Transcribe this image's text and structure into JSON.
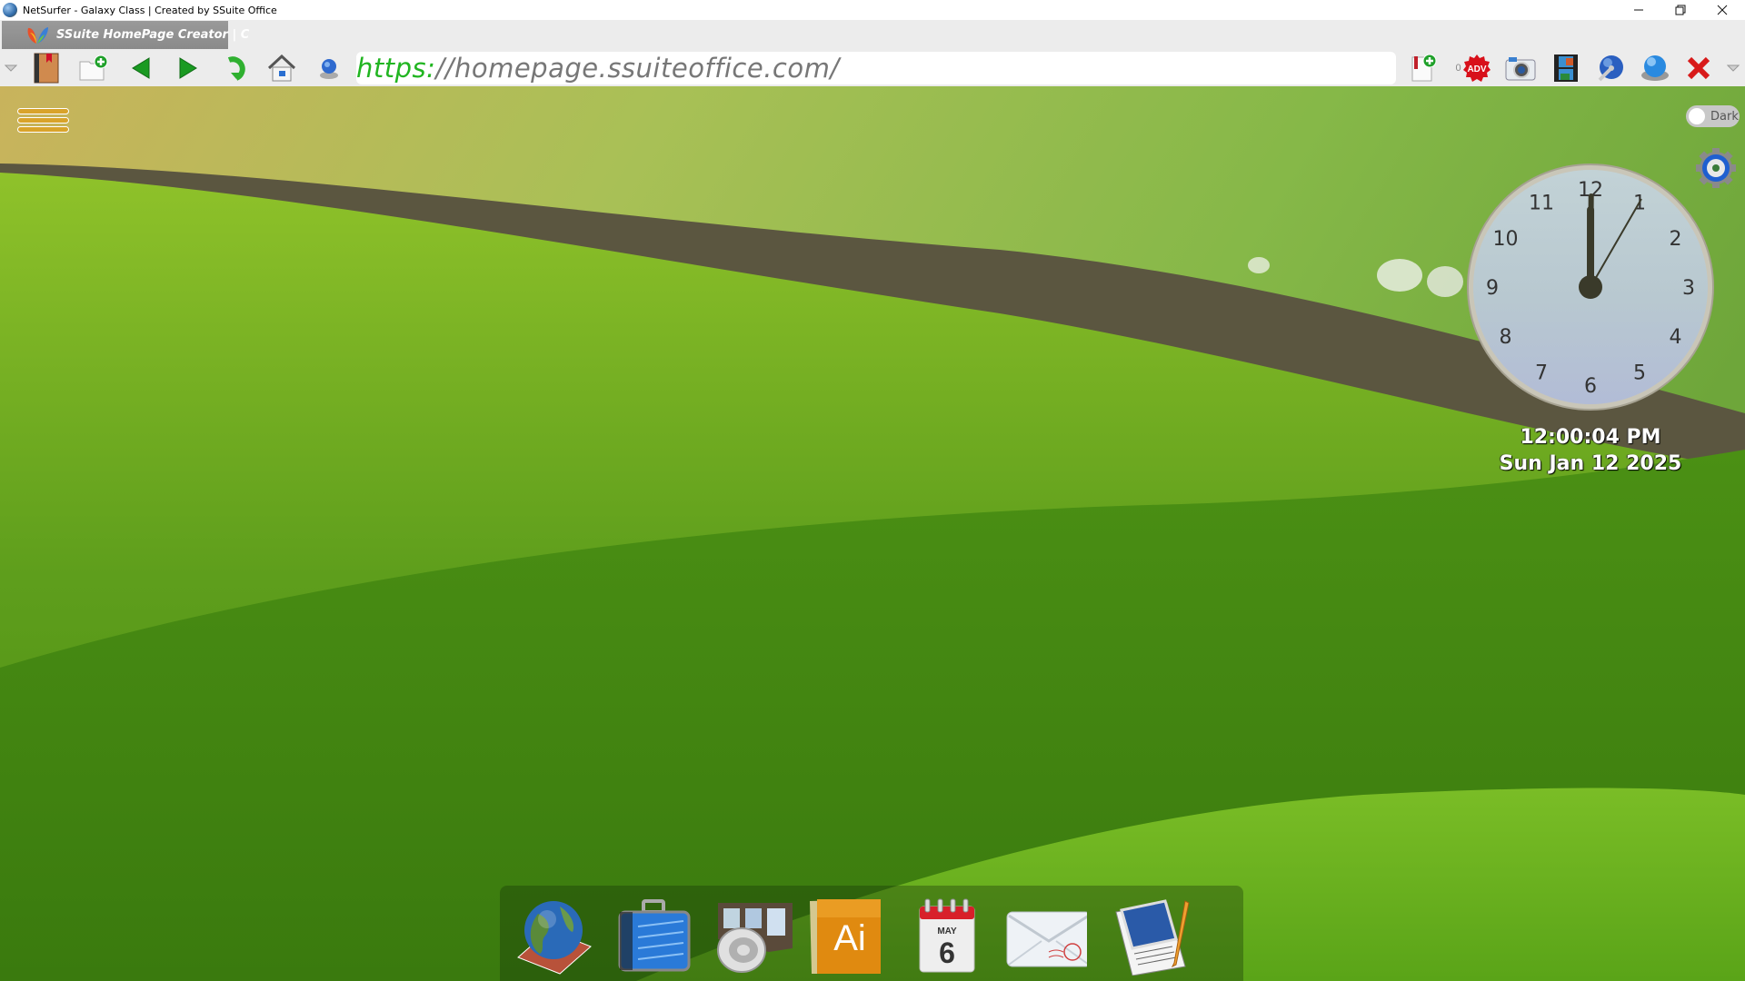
{
  "window": {
    "title": "NetSurfer - Galaxy Class | Created by SSuite Office",
    "controls": {
      "minimize": "—",
      "restore": "❐",
      "close": "✕"
    }
  },
  "tabs": [
    {
      "title": "SSuite HomePage Creator | C",
      "icon": "ssuite-butterfly-icon",
      "active": true
    }
  ],
  "toolbar": {
    "left_buttons": [
      {
        "name": "tab-menu-dropdown",
        "icon": "chevron-down-icon"
      },
      {
        "name": "bookmarks",
        "icon": "bookmark-book-icon"
      },
      {
        "name": "new-tab",
        "icon": "new-tab-plus-icon"
      },
      {
        "name": "back",
        "icon": "arrow-left-icon"
      },
      {
        "name": "forward",
        "icon": "arrow-right-icon"
      },
      {
        "name": "reload",
        "icon": "reload-icon"
      },
      {
        "name": "home",
        "icon": "home-icon"
      },
      {
        "name": "site-info",
        "icon": "globe-icon"
      }
    ],
    "url": {
      "scheme": "https:",
      "rest": "//homepage.ssuiteoffice.com/"
    },
    "right_buttons": [
      {
        "name": "add-bookmark",
        "icon": "bookmark-add-icon"
      },
      {
        "name": "adblock",
        "icon": "adv-badge-icon",
        "count": "0",
        "label": "ADV"
      },
      {
        "name": "screenshot",
        "icon": "camera-icon"
      },
      {
        "name": "media",
        "icon": "film-icon"
      },
      {
        "name": "settings-tools",
        "icon": "wrench-globe-icon"
      },
      {
        "name": "network",
        "icon": "globe-gear-icon"
      },
      {
        "name": "close-tab",
        "icon": "close-x-icon"
      },
      {
        "name": "more-dropdown",
        "icon": "chevron-down-icon"
      }
    ]
  },
  "page": {
    "menu_icon": "hamburger-icon",
    "theme_toggle": {
      "label": "Dark",
      "on": false
    },
    "settings_icon": "gear-icon",
    "clock": {
      "numerals": [
        "12",
        "1",
        "2",
        "3",
        "4",
        "5",
        "6",
        "7",
        "8",
        "9",
        "10",
        "11"
      ],
      "hours": 12,
      "minutes": 0,
      "seconds": 4
    },
    "time_text": "12:00:04 PM",
    "date_text": "Sun Jan 12 2025",
    "dock": [
      {
        "name": "web-browser",
        "icon": "globe-book-icon"
      },
      {
        "name": "briefcase",
        "icon": "briefcase-icon"
      },
      {
        "name": "multimedia",
        "icon": "speaker-film-icon"
      },
      {
        "name": "graphics",
        "icon": "ai-box-icon",
        "label": "Ai"
      },
      {
        "name": "calendar",
        "icon": "calendar-icon",
        "month": "MAY",
        "day": "6"
      },
      {
        "name": "email",
        "icon": "envelope-icon"
      },
      {
        "name": "journal",
        "icon": "journal-pencil-icon"
      }
    ]
  }
}
